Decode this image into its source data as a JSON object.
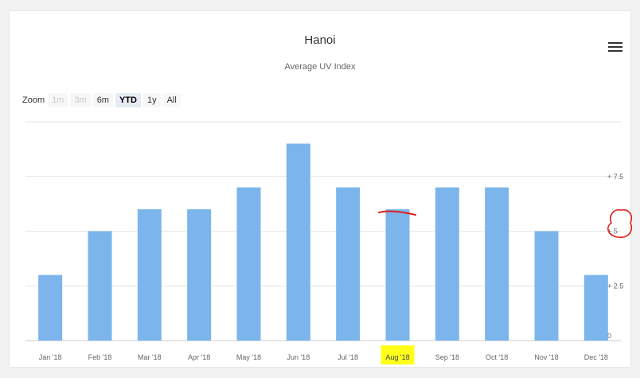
{
  "header": {
    "title": "Hanoi",
    "subtitle": "Average UV Index"
  },
  "zoom": {
    "label": "Zoom",
    "buttons": [
      {
        "label": "1m",
        "state": "disabled"
      },
      {
        "label": "3m",
        "state": "disabled"
      },
      {
        "label": "6m",
        "state": "normal"
      },
      {
        "label": "YTD",
        "state": "active"
      },
      {
        "label": "1y",
        "state": "normal"
      },
      {
        "label": "All",
        "state": "normal"
      }
    ]
  },
  "menu": {
    "icon": "hamburger-menu-icon"
  },
  "colors": {
    "bar": "#7cb5ec",
    "grid": "#e6e6e6",
    "highlight": "#ffff1a",
    "annotation": "#e0201b"
  },
  "chart_data": {
    "type": "bar",
    "categories": [
      "Jan '18",
      "Feb '18",
      "Mar '18",
      "Apr '18",
      "May '18",
      "Jun '18",
      "Jul '18",
      "Aug '18",
      "Sep '18",
      "Oct '18",
      "Nov '18",
      "Dec '18"
    ],
    "values": [
      3,
      5,
      6,
      6,
      7,
      9,
      7,
      6,
      7,
      7,
      5,
      3
    ],
    "title": "Hanoi",
    "subtitle": "Average UV Index",
    "xlabel": "",
    "ylabel": "",
    "ylim": [
      0,
      10
    ],
    "y_ticks": [
      0,
      2.5,
      5,
      7.5
    ],
    "y_tick_labels": [
      "0",
      "+ 2.5",
      "+ 5",
      "+ 7.5"
    ],
    "y_axis_side": "right",
    "grid": true,
    "legend": "none",
    "highlighted_category": "Aug '18"
  }
}
